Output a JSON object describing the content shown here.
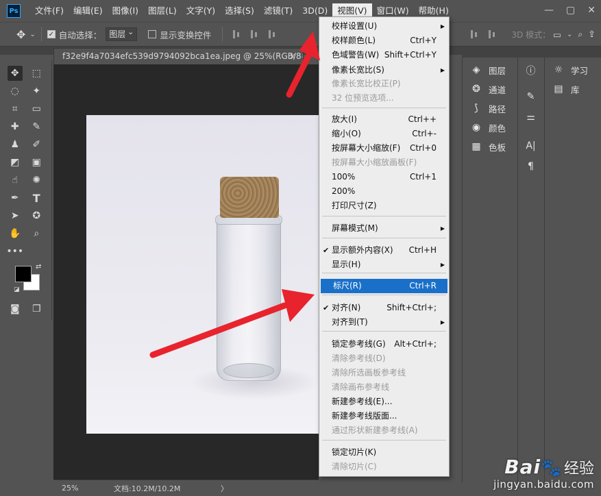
{
  "app": {
    "logo": "Ps"
  },
  "menubar": {
    "items": [
      "文件(F)",
      "编辑(E)",
      "图像(I)",
      "图层(L)",
      "文字(Y)",
      "选择(S)",
      "滤镜(T)",
      "3D(D)",
      "视图(V)",
      "窗口(W)",
      "帮助(H)"
    ],
    "active_index": 8
  },
  "window_controls": {
    "minimize": "—",
    "restore": "▢",
    "close": "✕"
  },
  "options_bar": {
    "auto_select_label": "自动选择：",
    "auto_select_value": "图层",
    "show_transform_label": "显示变换控件",
    "mode_3d_label": "3D 模式："
  },
  "document": {
    "tab_title": "f32e9f4a7034efc539d9794092bca1ea.jpeg @ 25%(RGB/8#)",
    "tab_close": "×"
  },
  "status": {
    "zoom": "25%",
    "doc_info": "文档:10.2M/10.2M",
    "arrow": "〉"
  },
  "view_menu": {
    "items": [
      {
        "label": "校样设置(U)",
        "shortcut": "",
        "submenu": true,
        "disabled": false,
        "checked": false
      },
      {
        "label": "校样颜色(L)",
        "shortcut": "Ctrl+Y",
        "submenu": false,
        "disabled": false,
        "checked": false
      },
      {
        "label": "色域警告(W)",
        "shortcut": "Shift+Ctrl+Y",
        "submenu": false,
        "disabled": false,
        "checked": false
      },
      {
        "label": "像素长宽比(S)",
        "shortcut": "",
        "submenu": true,
        "disabled": false,
        "checked": false
      },
      {
        "label": "像素长宽比校正(P)",
        "shortcut": "",
        "submenu": false,
        "disabled": true,
        "checked": false
      },
      {
        "label": "32 位预览选项...",
        "shortcut": "",
        "submenu": false,
        "disabled": true,
        "checked": false
      },
      {
        "label": "放大(I)",
        "shortcut": "Ctrl++",
        "submenu": false,
        "disabled": false,
        "checked": false
      },
      {
        "label": "缩小(O)",
        "shortcut": "Ctrl+-",
        "submenu": false,
        "disabled": false,
        "checked": false
      },
      {
        "label": "按屏幕大小缩放(F)",
        "shortcut": "Ctrl+0",
        "submenu": false,
        "disabled": false,
        "checked": false
      },
      {
        "label": "按屏幕大小缩放画板(F)",
        "shortcut": "",
        "submenu": false,
        "disabled": true,
        "checked": false
      },
      {
        "label": "100%",
        "shortcut": "Ctrl+1",
        "submenu": false,
        "disabled": false,
        "checked": false
      },
      {
        "label": "200%",
        "shortcut": "",
        "submenu": false,
        "disabled": false,
        "checked": false
      },
      {
        "label": "打印尺寸(Z)",
        "shortcut": "",
        "submenu": false,
        "disabled": false,
        "checked": false
      },
      {
        "label": "屏幕模式(M)",
        "shortcut": "",
        "submenu": true,
        "disabled": false,
        "checked": false
      },
      {
        "label": "显示额外内容(X)",
        "shortcut": "Ctrl+H",
        "submenu": false,
        "disabled": false,
        "checked": true
      },
      {
        "label": "显示(H)",
        "shortcut": "",
        "submenu": true,
        "disabled": false,
        "checked": false
      },
      {
        "label": "标尺(R)",
        "shortcut": "Ctrl+R",
        "submenu": false,
        "disabled": false,
        "checked": false,
        "highlighted": true
      },
      {
        "label": "对齐(N)",
        "shortcut": "Shift+Ctrl+;",
        "submenu": false,
        "disabled": false,
        "checked": true
      },
      {
        "label": "对齐到(T)",
        "shortcut": "",
        "submenu": true,
        "disabled": false,
        "checked": false
      },
      {
        "label": "锁定参考线(G)",
        "shortcut": "Alt+Ctrl+;",
        "submenu": false,
        "disabled": false,
        "checked": false
      },
      {
        "label": "清除参考线(D)",
        "shortcut": "",
        "submenu": false,
        "disabled": true,
        "checked": false
      },
      {
        "label": "清除所选画板参考线",
        "shortcut": "",
        "submenu": false,
        "disabled": true,
        "checked": false
      },
      {
        "label": "清除画布参考线",
        "shortcut": "",
        "submenu": false,
        "disabled": true,
        "checked": false
      },
      {
        "label": "新建参考线(E)...",
        "shortcut": "",
        "submenu": false,
        "disabled": false,
        "checked": false
      },
      {
        "label": "新建参考线版面...",
        "shortcut": "",
        "submenu": false,
        "disabled": false,
        "checked": false
      },
      {
        "label": "通过形状新建参考线(A)",
        "shortcut": "",
        "submenu": false,
        "disabled": true,
        "checked": false
      },
      {
        "label": "锁定切片(K)",
        "shortcut": "",
        "submenu": false,
        "disabled": false,
        "checked": false
      },
      {
        "label": "清除切片(C)",
        "shortcut": "",
        "submenu": false,
        "disabled": true,
        "checked": false
      }
    ]
  },
  "panels": {
    "primary": [
      {
        "label": "图层",
        "icon": "layers-icon"
      },
      {
        "label": "通道",
        "icon": "channels-icon"
      },
      {
        "label": "路径",
        "icon": "paths-icon"
      },
      {
        "label": "颜色",
        "icon": "color-icon"
      },
      {
        "label": "色板",
        "icon": "swatches-icon"
      }
    ],
    "learn_label": "学习",
    "library_label": "库"
  },
  "watermark": {
    "logo": "Bai",
    "cn": "经验",
    "url": "jingyan.baidu.com"
  },
  "colors": {
    "accent_highlight": "#1a70c9",
    "arrow_red": "#e8232d",
    "ps_blue": "#31a8ff"
  }
}
